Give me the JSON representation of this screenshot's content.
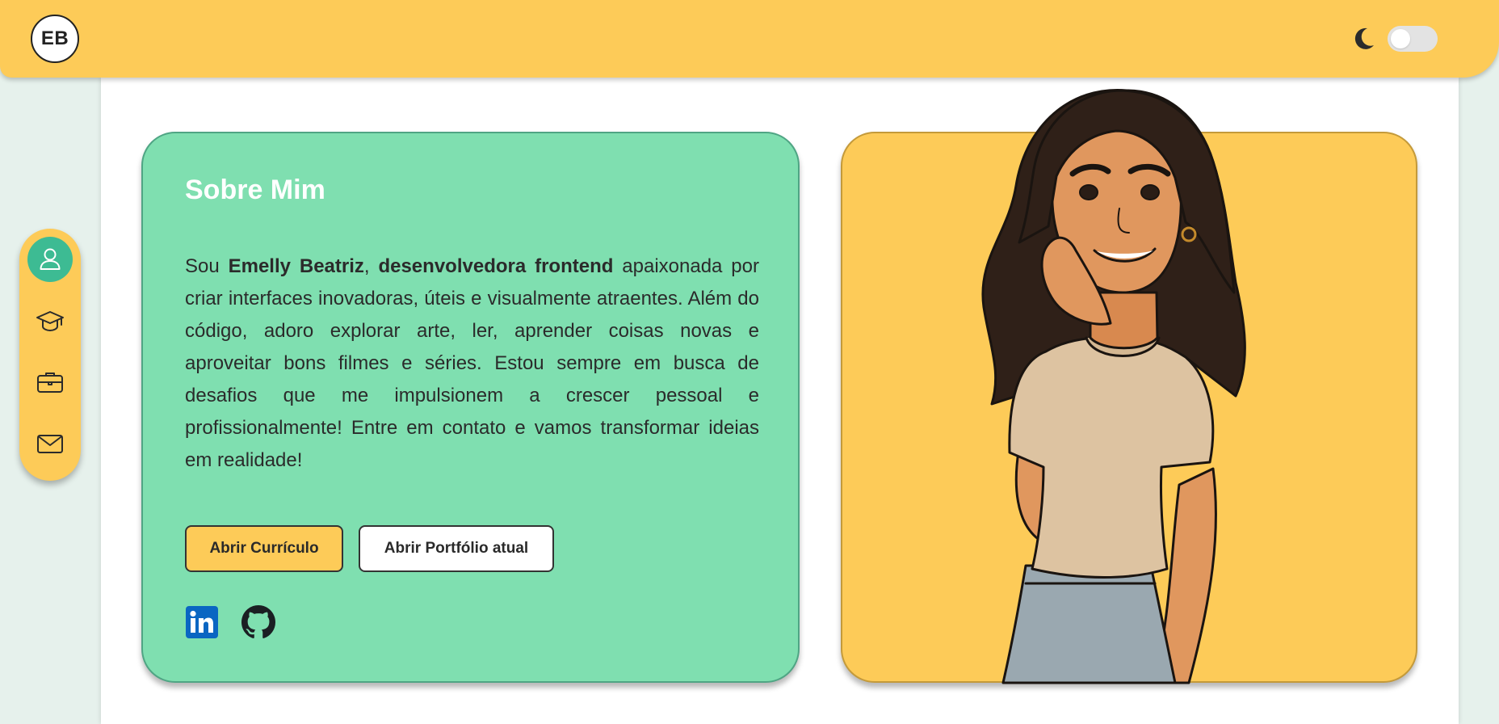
{
  "header": {
    "logo_text": "EB",
    "theme_toggle": {
      "icon": "moon-icon",
      "state": "off"
    }
  },
  "sidebar": {
    "items": [
      {
        "name": "about",
        "icon": "user-icon",
        "active": true
      },
      {
        "name": "education",
        "icon": "graduation-cap-icon",
        "active": false
      },
      {
        "name": "experience",
        "icon": "briefcase-icon",
        "active": false
      },
      {
        "name": "contact",
        "icon": "mail-icon",
        "active": false
      }
    ]
  },
  "about": {
    "title": "Sobre Mim",
    "intro": "Sou ",
    "name": "Emelly Beatriz",
    "sep": ", ",
    "role": "desenvolvedora frontend",
    "body": " apaixonada por criar interfaces inovadoras, úteis e visualmente atraentes. Além do código, adoro explorar arte, ler, aprender coisas novas e aproveitar bons filmes e séries. Estou sempre em busca de desafios que me impulsionem a crescer pessoal e profissionalmente! Entre em contato e vamos transformar ideias em realidade!",
    "buttons": {
      "resume": "Abrir Currículo",
      "portfolio": "Abrir Portfólio atual"
    },
    "socials": [
      {
        "name": "LinkedIn",
        "icon": "linkedin-icon",
        "color": "#0a66c2"
      },
      {
        "name": "GitHub",
        "icon": "github-icon",
        "color": "#1b1f23"
      }
    ]
  },
  "colors": {
    "accent_yellow": "#fdcb58",
    "card_green": "#7fdfb0",
    "active_teal": "#3dbb93",
    "page_bg": "#e6f1ec"
  }
}
